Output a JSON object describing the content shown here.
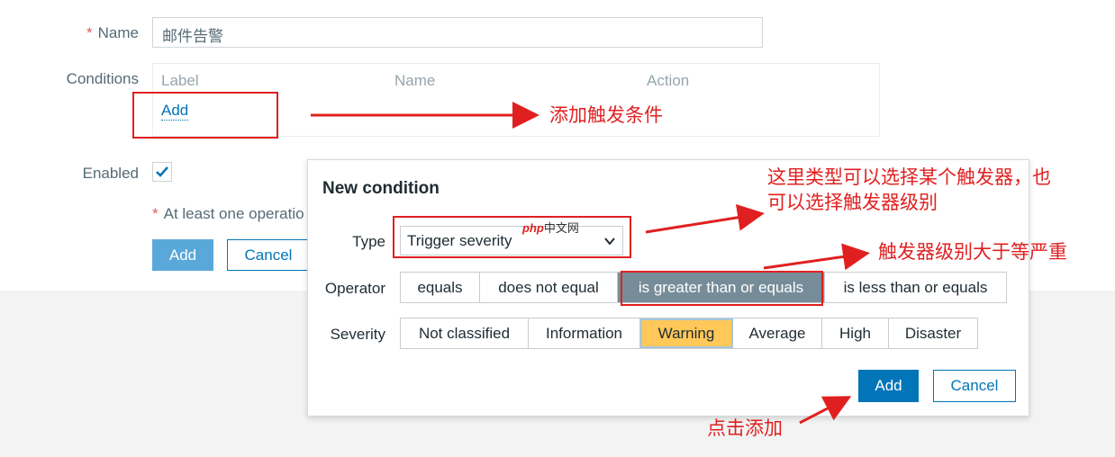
{
  "form": {
    "name_label": "Name",
    "name_required": "*",
    "name_value": "邮件告警",
    "conditions_label": "Conditions",
    "table_headers": [
      "Label",
      "Name",
      "Action"
    ],
    "add_link": "Add",
    "enabled_label": "Enabled",
    "enabled_checked": true,
    "warning_required": "*",
    "warning_text": "At least one operatio",
    "add_button": "Add",
    "cancel_button": "Cancel"
  },
  "dialog": {
    "title": "New condition",
    "type_label": "Type",
    "type_value": "Trigger severity",
    "operator_label": "Operator",
    "operators": [
      "equals",
      "does not equal",
      "is greater than or equals",
      "is less than or equals"
    ],
    "operator_selected": "is greater than or equals",
    "severity_label": "Severity",
    "severities": [
      "Not classified",
      "Information",
      "Warning",
      "Average",
      "High",
      "Disaster"
    ],
    "severity_selected": "Warning",
    "add_button": "Add",
    "cancel_button": "Cancel"
  },
  "annotations": {
    "add_trigger_condition": "添加触发条件",
    "type_note_line1": "这里类型可以选择某个触发器，也",
    "type_note_line2": "可以选择触发器级别",
    "severity_note": "触发器级别大于等严重",
    "click_add_note": "点击添加",
    "watermark_php": "php",
    "watermark_site": "中文网"
  },
  "colors": {
    "primary": "#0275b8",
    "severity_warning": "#ffc859",
    "operator_selected": "#768d99",
    "annotation": "#e02020"
  }
}
